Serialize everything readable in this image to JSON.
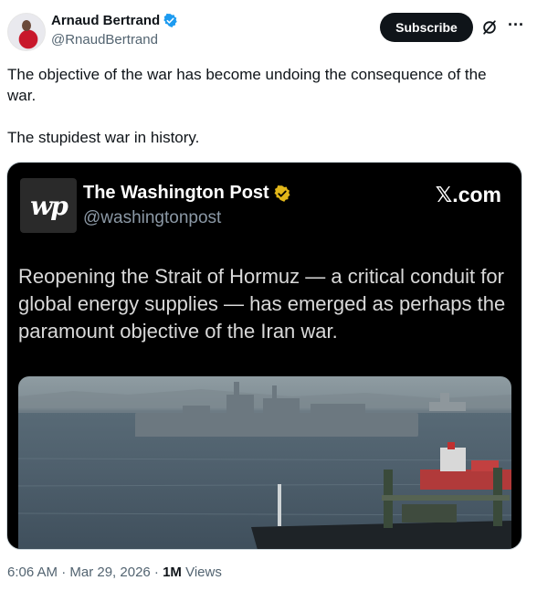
{
  "author": {
    "name": "Arnaud Bertrand",
    "handle": "@RnaudBertrand",
    "verified_color": "#1d9bf0"
  },
  "actions": {
    "subscribe_label": "Subscribe",
    "grok_icon": "slashed-circle-icon",
    "more_icon": "more-icon",
    "more_glyph": "···"
  },
  "tweet": {
    "paragraph1": "The objective of the war has become undoing the consequence of the war.",
    "paragraph2": "The stupidest war in history."
  },
  "embedded_post": {
    "logo_text": "wp",
    "source_name": "The Washington Post",
    "source_handle": "@washingtonpost",
    "badge_color": "#e2b719",
    "site": "𝕏.com",
    "headline": "Reopening the Strait of Hormuz — a critical conduit for global energy supplies — has emerged as perhaps the paramount objective of the Iran war."
  },
  "meta": {
    "timestamp": "6:06 AM · Mar 29, 2026 · ",
    "views_count": "1M",
    "views_label": " Views"
  }
}
